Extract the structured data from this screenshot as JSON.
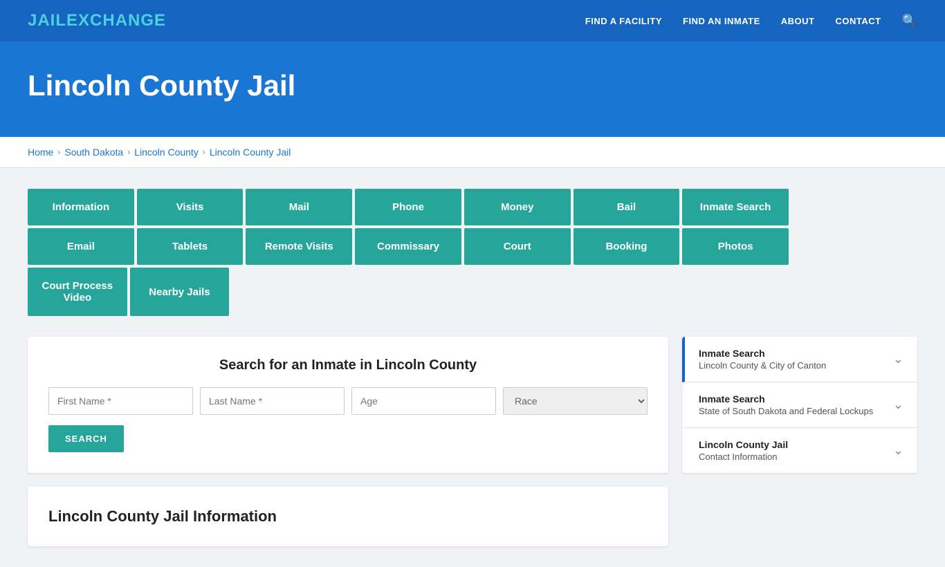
{
  "header": {
    "logo_jail": "JAIL",
    "logo_exchange": "EXCHANGE",
    "nav": [
      {
        "id": "find-facility",
        "label": "FIND A FACILITY"
      },
      {
        "id": "find-inmate",
        "label": "FIND AN INMATE"
      },
      {
        "id": "about",
        "label": "ABOUT"
      },
      {
        "id": "contact",
        "label": "CONTACT"
      }
    ]
  },
  "hero": {
    "title": "Lincoln County Jail"
  },
  "breadcrumb": {
    "items": [
      {
        "label": "Home",
        "id": "home"
      },
      {
        "label": "South Dakota",
        "id": "south-dakota"
      },
      {
        "label": "Lincoln County",
        "id": "lincoln-county"
      },
      {
        "label": "Lincoln County Jail",
        "id": "lincoln-county-jail"
      }
    ]
  },
  "nav_buttons": {
    "row1": [
      {
        "id": "information",
        "label": "Information"
      },
      {
        "id": "visits",
        "label": "Visits"
      },
      {
        "id": "mail",
        "label": "Mail"
      },
      {
        "id": "phone",
        "label": "Phone"
      },
      {
        "id": "money",
        "label": "Money"
      },
      {
        "id": "bail",
        "label": "Bail"
      },
      {
        "id": "inmate-search",
        "label": "Inmate Search"
      }
    ],
    "row2": [
      {
        "id": "email",
        "label": "Email"
      },
      {
        "id": "tablets",
        "label": "Tablets"
      },
      {
        "id": "remote-visits",
        "label": "Remote Visits"
      },
      {
        "id": "commissary",
        "label": "Commissary"
      },
      {
        "id": "court",
        "label": "Court"
      },
      {
        "id": "booking",
        "label": "Booking"
      },
      {
        "id": "photos",
        "label": "Photos"
      }
    ],
    "row3": [
      {
        "id": "court-process-video",
        "label": "Court Process Video"
      },
      {
        "id": "nearby-jails",
        "label": "Nearby Jails"
      }
    ]
  },
  "search_section": {
    "title": "Search for an Inmate in Lincoln County",
    "first_name_placeholder": "First Name *",
    "last_name_placeholder": "Last Name *",
    "age_placeholder": "Age",
    "race_placeholder": "Race",
    "search_button": "SEARCH"
  },
  "info_section": {
    "title": "Lincoln County Jail Information"
  },
  "sidebar": {
    "items": [
      {
        "id": "inmate-search-lincoln",
        "title": "Inmate Search",
        "subtitle": "Lincoln County & City of Canton",
        "active": true
      },
      {
        "id": "inmate-search-state",
        "title": "Inmate Search",
        "subtitle": "State of South Dakota and Federal Lockups",
        "active": false
      },
      {
        "id": "contact-info",
        "title": "Lincoln County Jail",
        "subtitle": "Contact Information",
        "active": false
      }
    ]
  }
}
